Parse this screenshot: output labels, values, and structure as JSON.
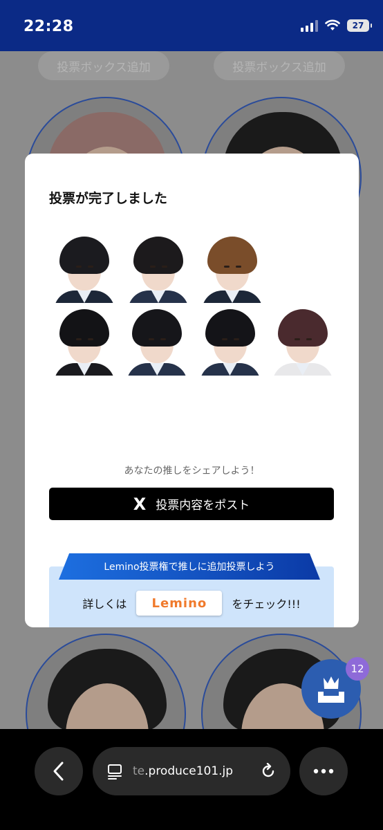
{
  "status_bar": {
    "time": "22:28",
    "battery": "27"
  },
  "background": {
    "add_box_buttons": [
      "投票ボックス追加",
      "投票ボックス追加"
    ]
  },
  "modal": {
    "title": "投票が完了しました",
    "members_row1": [
      {
        "hair": "#1b1b1f",
        "body": "#1d2738"
      },
      {
        "hair": "#1c1a1c",
        "body": "#26324a"
      },
      {
        "hair": "#7a4d2a",
        "body": "#1d2738"
      }
    ],
    "members_row2": [
      {
        "hair": "#131316",
        "body": "#1a1a1e"
      },
      {
        "hair": "#16161a",
        "body": "#26324a"
      },
      {
        "hair": "#141418",
        "body": "#26324a"
      },
      {
        "hair": "#4a2a2e",
        "body": "#e8e8ea"
      }
    ],
    "share_note": "あなたの推しをシェアしよう！",
    "post_button": {
      "icon": "X",
      "label": "投票内容をポスト"
    },
    "lemino": {
      "banner": "Lemino投票権で推しに追加投票しよう",
      "prefix": "詳しくは",
      "logo": "Lemino",
      "suffix": "をチェック!!!"
    }
  },
  "vote_badge": {
    "count": "12"
  },
  "browser": {
    "url_prefix": "te",
    "url_rest": ".produce101.jp"
  },
  "colors": {
    "status_bar": "#0b2a86",
    "post_button": "#000000",
    "lemino_box": "#cfe4fb",
    "vote_fab": "#2c5db0",
    "vote_count": "#8e6ad8"
  }
}
